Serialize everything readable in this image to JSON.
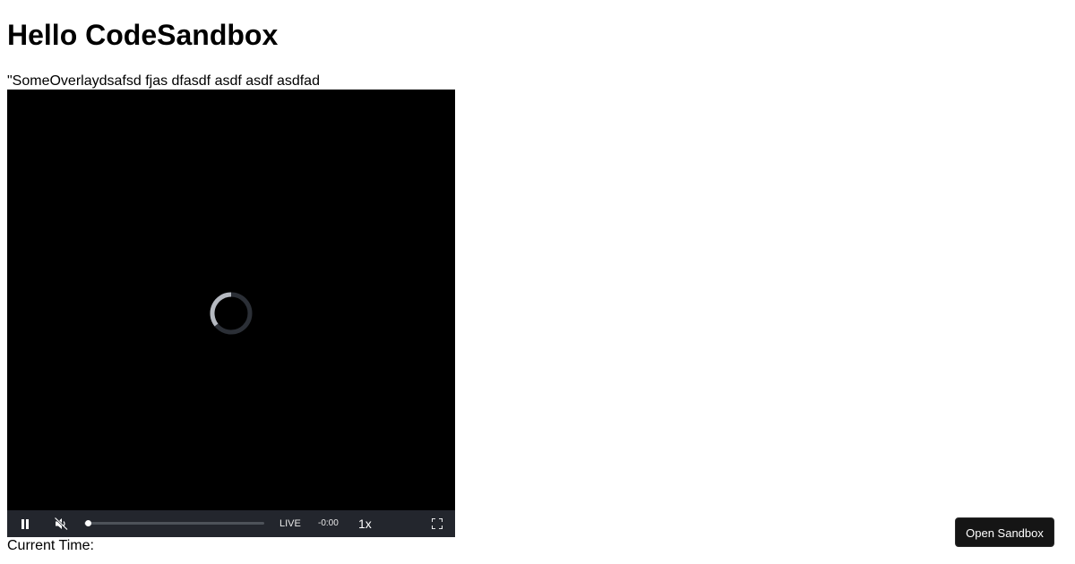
{
  "page": {
    "heading": "Hello CodeSandbox",
    "overlay_text": "\"SomeOverlaydsafsd fjas dfasdf asdf asdf asdfad",
    "current_time_label": "Current Time:"
  },
  "player": {
    "state": "loading",
    "progress_fraction": 0.0,
    "controls": {
      "play_pause_icon": "pause-icon",
      "mute_icon": "volume-muted-icon",
      "live_label": "LIVE",
      "remaining_time": "-0:00",
      "playback_rate": "1x",
      "fullscreen_icon": "fullscreen-icon"
    }
  },
  "codesandbox": {
    "open_button_label": "Open Sandbox"
  },
  "colors": {
    "control_bar_bg": "#23262d",
    "player_bg": "#000000",
    "button_bg": "#151515"
  }
}
